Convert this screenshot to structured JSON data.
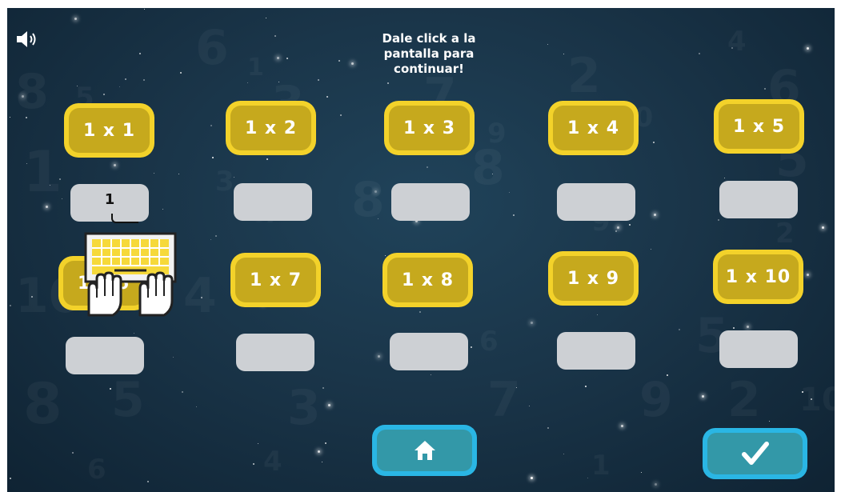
{
  "prompt": "Dale click a la\npantalla para\ncontinuar!",
  "sound_icon": "speaker-volume-icon",
  "tiles": [
    {
      "label": "1 x 1"
    },
    {
      "label": "1 x 2"
    },
    {
      "label": "1 x 3"
    },
    {
      "label": "1 x 4"
    },
    {
      "label": "1 x 5"
    },
    {
      "label": "1 x 6"
    },
    {
      "label": "1 x 7"
    },
    {
      "label": "1 x 8"
    },
    {
      "label": "1 x 9"
    },
    {
      "label": "1 x 10"
    }
  ],
  "answers": [
    {
      "value": "1"
    },
    {
      "value": ""
    },
    {
      "value": ""
    },
    {
      "value": ""
    },
    {
      "value": ""
    },
    {
      "value": ""
    },
    {
      "value": ""
    },
    {
      "value": ""
    },
    {
      "value": ""
    },
    {
      "value": ""
    }
  ],
  "hint_icon": "keyboard-hands-icon",
  "home_button": {
    "icon": "home-icon"
  },
  "check_button": {
    "icon": "checkmark-icon"
  },
  "background_numbers": [
    "6",
    "1",
    "8",
    "5",
    "3",
    "7",
    "9",
    "2",
    "10",
    "4"
  ],
  "colors": {
    "background": "#1a3549",
    "tile_border": "#f3d22a",
    "tile_fill": "#c6a91d",
    "answer_box": "#cdd0d4",
    "button_border": "#2ab6e4",
    "button_fill": "#3398a8"
  }
}
